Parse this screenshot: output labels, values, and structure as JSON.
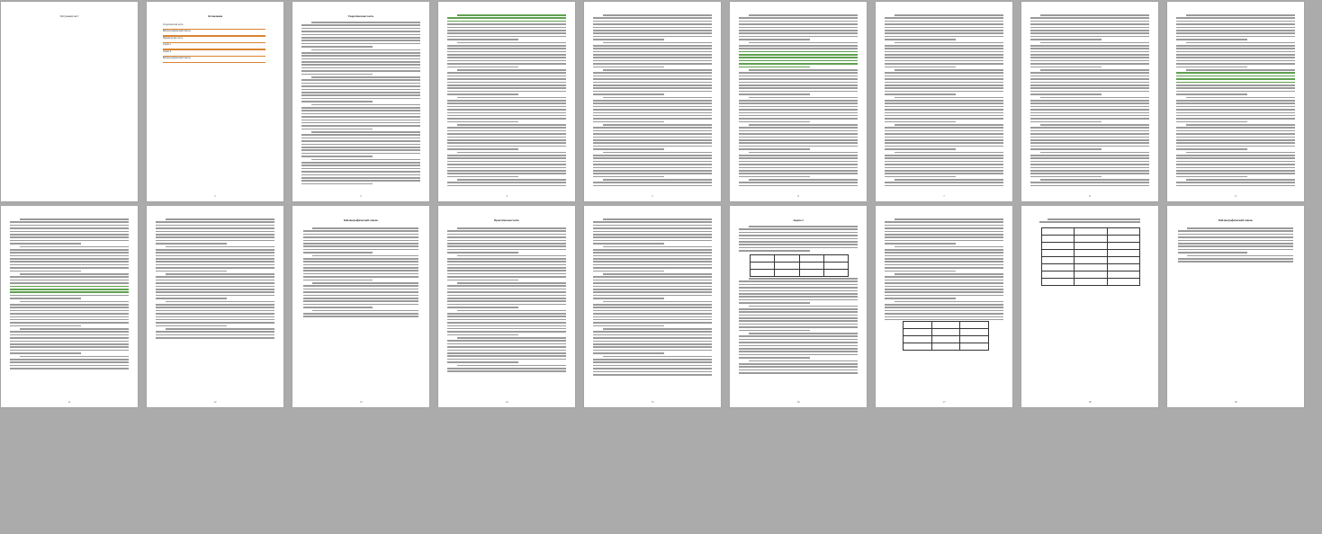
{
  "document": {
    "view": "multi-page document thumbnail view",
    "pages_row1": [
      {
        "id": "p1",
        "title": "Титульный лист",
        "number": ""
      },
      {
        "id": "p2",
        "title": "Оглавление",
        "number": "2"
      },
      {
        "id": "p3",
        "title": "Теоретическая часть",
        "number": "3"
      },
      {
        "id": "p4",
        "title": "",
        "number": "4"
      },
      {
        "id": "p5",
        "title": "",
        "number": "5"
      },
      {
        "id": "p6",
        "title": "",
        "number": "6"
      },
      {
        "id": "p7",
        "title": "",
        "number": "7"
      },
      {
        "id": "p8",
        "title": "",
        "number": "8"
      },
      {
        "id": "p9",
        "title": "",
        "number": "9"
      },
      {
        "id": "p10",
        "title": "",
        "number": "10"
      }
    ],
    "pages_row2": [
      {
        "id": "p11",
        "title": "",
        "number": "11"
      },
      {
        "id": "p12",
        "title": "",
        "number": "12"
      },
      {
        "id": "p13",
        "title": "Библиографический список",
        "number": "13"
      },
      {
        "id": "p14",
        "title": "Практическая часть",
        "number": "14"
      },
      {
        "id": "p15",
        "title": "",
        "number": "15"
      },
      {
        "id": "p16",
        "title": "Задача 2",
        "number": "16"
      },
      {
        "id": "p17",
        "title": "",
        "number": "17"
      },
      {
        "id": "p18",
        "title": "",
        "number": "18"
      },
      {
        "id": "p19",
        "title": "Библиографический список",
        "number": "19"
      }
    ],
    "toc": {
      "items": [
        "Теоретическая часть",
        "Библиографический список",
        "Практическая часть",
        "Задача 1",
        "Задача 2",
        "Библиографический список"
      ]
    }
  }
}
